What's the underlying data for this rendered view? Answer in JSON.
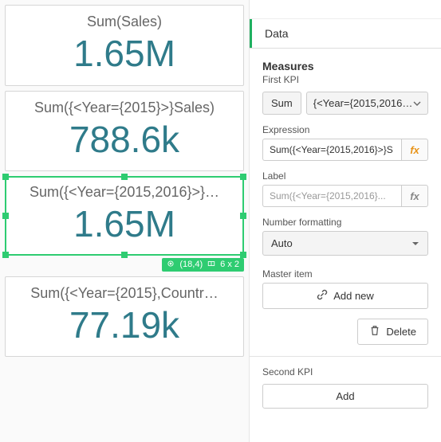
{
  "canvas": {
    "cards": [
      {
        "title": "Sum(Sales)",
        "value": "1.65M"
      },
      {
        "title": "Sum({<Year={2015}>}Sales)",
        "value": "788.6k"
      },
      {
        "title": "Sum({<Year={2015,2016}>}…",
        "value": "1.65M",
        "selected": true
      },
      {
        "title": "Sum({<Year={2015},Countr…",
        "value": "77.19k"
      }
    ],
    "selection_badge": {
      "pos": "(18,4)",
      "size": "6 x 2"
    }
  },
  "panel": {
    "tab": "Data",
    "measures_title": "Measures",
    "first_kpi_label": "First KPI",
    "aggregation": "Sum",
    "agg_field": "{<Year={2015,2016…",
    "expression_label": "Expression",
    "expression_value": "Sum({<Year={2015,2016}>}S",
    "label_label": "Label",
    "label_placeholder": "Sum({<Year={2015,2016}...",
    "number_formatting_label": "Number formatting",
    "number_formatting_value": "Auto",
    "master_item_label": "Master item",
    "add_new_label": "Add new",
    "delete_label": "Delete",
    "second_kpi_label": "Second KPI",
    "add_label": "Add"
  }
}
